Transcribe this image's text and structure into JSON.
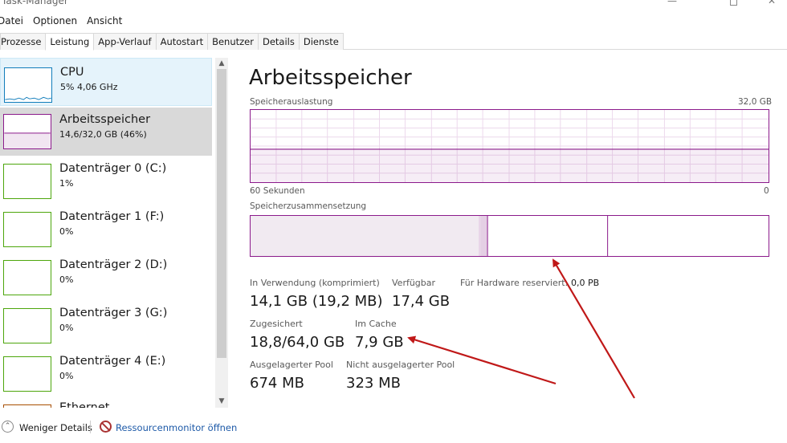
{
  "window": {
    "title": "Task-Manager",
    "minimize": "—",
    "close": "✕"
  },
  "menu": [
    "Datei",
    "Optionen",
    "Ansicht"
  ],
  "tabs": [
    "Prozesse",
    "Leistung",
    "App-Verlauf",
    "Autostart",
    "Benutzer",
    "Details",
    "Dienste"
  ],
  "sidebar": {
    "items": [
      {
        "name": "CPU",
        "sub": "5% 4,06 GHz"
      },
      {
        "name": "Arbeitsspeicher",
        "sub": "14,6/32,0 GB (46%)"
      },
      {
        "name": "Datenträger 0 (C:)",
        "sub": "1%"
      },
      {
        "name": "Datenträger 1 (F:)",
        "sub": "0%"
      },
      {
        "name": "Datenträger 2 (D:)",
        "sub": "0%"
      },
      {
        "name": "Datenträger 3 (G:)",
        "sub": "0%"
      },
      {
        "name": "Datenträger 4 (E:)",
        "sub": "0%"
      },
      {
        "name": "Ethernet",
        "sub": ""
      }
    ]
  },
  "main": {
    "title": "Arbeitsspeicher",
    "usage_label": "Speicherauslastung",
    "usage_max": "32,0 GB",
    "time_left": "60 Sekunden",
    "time_right": "0",
    "composition_label": "Speicherzusammensetzung",
    "stats": {
      "in_use_label": "In Verwendung (komprimiert)",
      "in_use_value": "14,1 GB (19,2 MB)",
      "available_label": "Verfügbar",
      "available_value": "17,4 GB",
      "hw_reserved_label": "Für Hardware reserviert:",
      "hw_reserved_value": "0,0 PB",
      "committed_label": "Zugesichert",
      "committed_value": "18,8/64,0 GB",
      "cached_label": "Im Cache",
      "cached_value": "7,9 GB",
      "paged_label": "Ausgelagerter Pool",
      "paged_value": "674 MB",
      "nonpaged_label": "Nicht ausgelagerter Pool",
      "nonpaged_value": "323 MB"
    }
  },
  "footer": {
    "less": "Weniger Details",
    "resource_monitor": "Ressourcenmonitor öffnen"
  },
  "colors": {
    "memory": "#8b1a8b",
    "cpu": "#117dbb",
    "disk": "#4da60c",
    "arrow": "#c01818",
    "link": "#1e5aa8"
  }
}
